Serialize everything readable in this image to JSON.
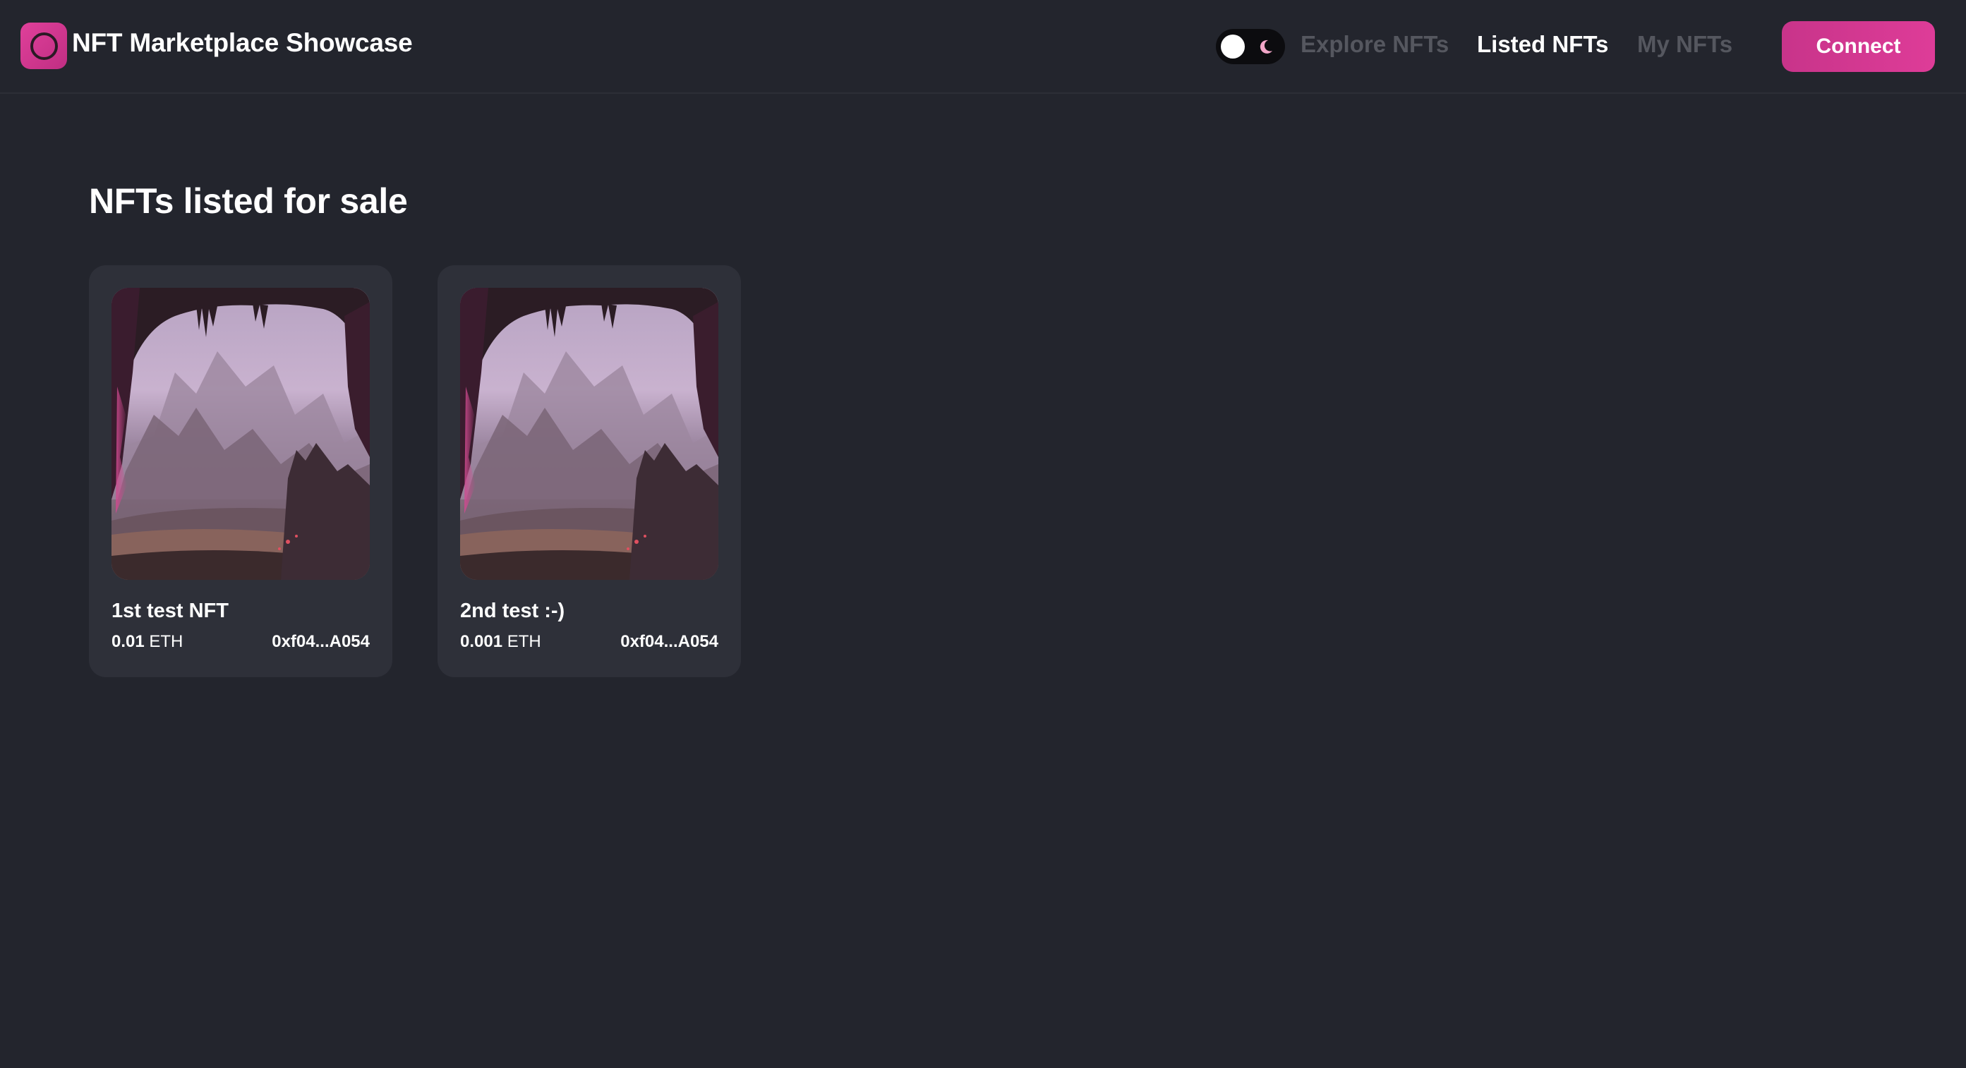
{
  "header": {
    "app_title": "NFT Marketplace Showcase",
    "nav": {
      "explore": "Explore NFTs",
      "listed": "Listed NFTs",
      "my": "My NFTs"
    },
    "connect_label": "Connect",
    "active_nav": "Listed NFTs"
  },
  "main": {
    "heading": "NFTs listed for sale",
    "nfts": [
      {
        "name": "1st test NFT",
        "price": "0.01",
        "currency": "ETH",
        "owner": "0xf04...A054"
      },
      {
        "name": "2nd test :-)",
        "price": "0.001",
        "currency": "ETH",
        "owner": "0xf04...A054"
      }
    ]
  },
  "colors": {
    "background": "#23252d",
    "card": "#2e3039",
    "accent": "#de3c98",
    "inactive_nav": "#55575f"
  },
  "icons": {
    "logo": "ring-logo-icon",
    "theme": "moon-icon"
  }
}
